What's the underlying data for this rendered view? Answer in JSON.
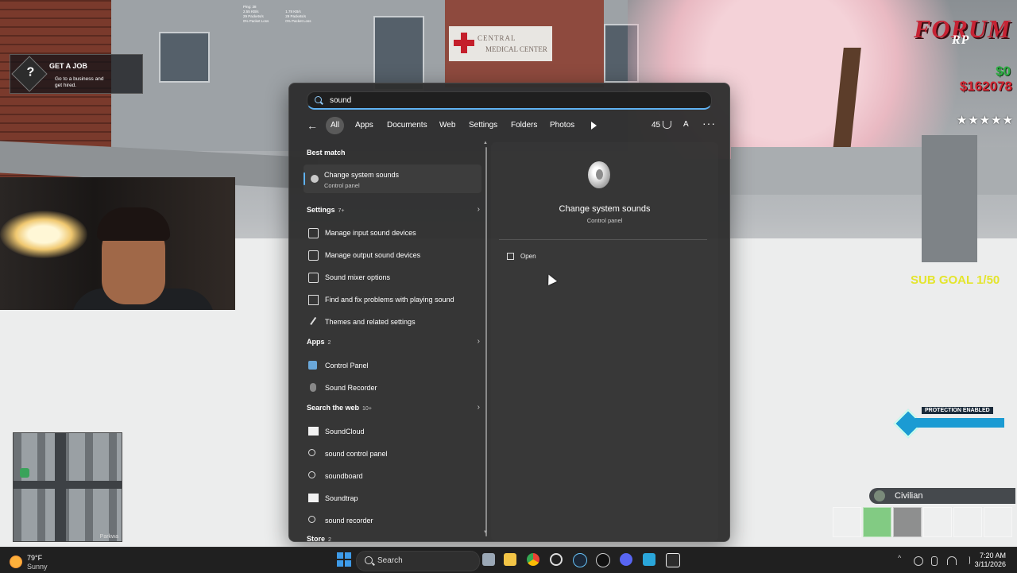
{
  "game": {
    "hud_stats": {
      "ping": "Ping: 38",
      "col1": [
        "2.55 KB/s",
        "29 Packets/s",
        "0% Packet Loss"
      ],
      "col2": [
        "1.78 KB/s",
        "29 Packets/s",
        "0% Packet Loss"
      ]
    },
    "sign": {
      "line1": "CENTRAL",
      "line2": "MEDICAL CENTER"
    },
    "job": {
      "title": "GET A JOB",
      "desc_line1": "Go to a business and",
      "desc_line2": "get hired."
    },
    "logo": {
      "main": "FORUM",
      "sub": "RP"
    },
    "money_cash": "$0",
    "money_bank": "$162078",
    "stars": "★★★★★",
    "sub_goal": "SUB GOAL 1/50",
    "protection_label": "PROTECTION ENABLED",
    "job_role": "Civilian",
    "minimap_label": "Parkwa"
  },
  "search_panel": {
    "query": "sound",
    "filters": [
      {
        "label": "All",
        "active": true
      },
      {
        "label": "Apps"
      },
      {
        "label": "Documents"
      },
      {
        "label": "Web"
      },
      {
        "label": "Settings"
      },
      {
        "label": "Folders"
      },
      {
        "label": "Photos"
      }
    ],
    "points": "45",
    "avatar_letter": "A",
    "more": "···",
    "best_match": {
      "header": "Best match",
      "title": "Change system sounds",
      "subtitle": "Control panel"
    },
    "settings": {
      "header": "Settings",
      "count": "7+",
      "items": [
        "Manage input sound devices",
        "Manage output sound devices",
        "Sound mixer options",
        "Find and fix problems with playing sound",
        "Themes and related settings"
      ]
    },
    "apps": {
      "header": "Apps",
      "count": "2",
      "items": [
        "Control Panel",
        "Sound Recorder"
      ]
    },
    "web": {
      "header": "Search the web",
      "count": "10+",
      "items": [
        "SoundCloud",
        "sound control panel",
        "soundboard",
        "Soundtrap",
        "sound recorder"
      ]
    },
    "store": {
      "header": "Store",
      "count": "2"
    },
    "preview": {
      "title": "Change system sounds",
      "subtitle": "Control panel",
      "action_open": "Open"
    }
  },
  "taskbar": {
    "weather_temp": "79°F",
    "weather_cond": "Sunny",
    "search_label": "Search",
    "time": "7:20 AM",
    "date": "3/11/2026"
  }
}
